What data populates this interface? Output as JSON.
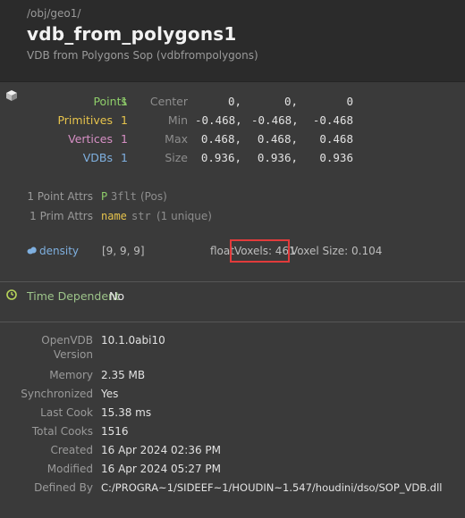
{
  "header": {
    "path": "/obj/geo1/",
    "title": "vdb_from_polygons1",
    "subtitle": "VDB from Polygons Sop (vdbfrompolygons)"
  },
  "stats": {
    "points": {
      "label": "Points",
      "count": "1"
    },
    "primitives": {
      "label": "Primitives",
      "count": "1"
    },
    "vertices": {
      "label": "Vertices",
      "count": "1"
    },
    "vdbs": {
      "label": "VDBs",
      "count": "1"
    }
  },
  "bbox": {
    "center": {
      "label": "Center",
      "x": "0,",
      "y": "0,",
      "z": "0"
    },
    "min": {
      "label": "Min",
      "x": "-0.468,",
      "y": "-0.468,",
      "z": "-0.468"
    },
    "max": {
      "label": "Max",
      "x": "0.468,",
      "y": "0.468,",
      "z": "0.468"
    },
    "size": {
      "label": "Size",
      "x": "0.936,",
      "y": "0.936,",
      "z": "0.936"
    }
  },
  "attributes": {
    "point": {
      "label": "1 Point Attrs",
      "name": "P",
      "type": "3flt",
      "note": "(Pos)"
    },
    "prim": {
      "label": "1 Prim Attrs",
      "name": "name",
      "type": "str",
      "note": "(1 unique)"
    }
  },
  "volume": {
    "name": "density",
    "resolution": "[9, 9, 9]",
    "type": "float",
    "voxels": "Voxels: 461",
    "voxel_size": "Voxel Size: 0.104"
  },
  "time_dependent": {
    "label": "Time Dependent",
    "value": "No"
  },
  "info": {
    "openvdb_label_1": "OpenVDB",
    "openvdb_label_2": "Version",
    "openvdb_value": "10.1.0abi10",
    "memory_label": "Memory",
    "memory_value": "2.35 MB",
    "synchronized_label": "Synchronized",
    "synchronized_value": "Yes",
    "last_cook_label": "Last Cook",
    "last_cook_value": "15.38 ms",
    "total_cooks_label": "Total Cooks",
    "total_cooks_value": "1516",
    "created_label": "Created",
    "created_value": "16 Apr 2024 02:36 PM",
    "modified_label": "Modified",
    "modified_value": "16 Apr 2024 05:27 PM",
    "defined_by_label": "Defined By",
    "defined_by_value": "C:/PROGRA~1/SIDEEF~1/HOUDIN~1.547/houdini/dso/SOP_VDB.dll"
  },
  "colors": {
    "points": "#8fce6a",
    "primitives": "#e6c34c",
    "vertices": "#d68fc4",
    "vdbs": "#7fb0e0",
    "highlight": "#e23b3b"
  },
  "icons": [
    "geometry-cube-icon",
    "volume-icon",
    "clock-icon"
  ]
}
